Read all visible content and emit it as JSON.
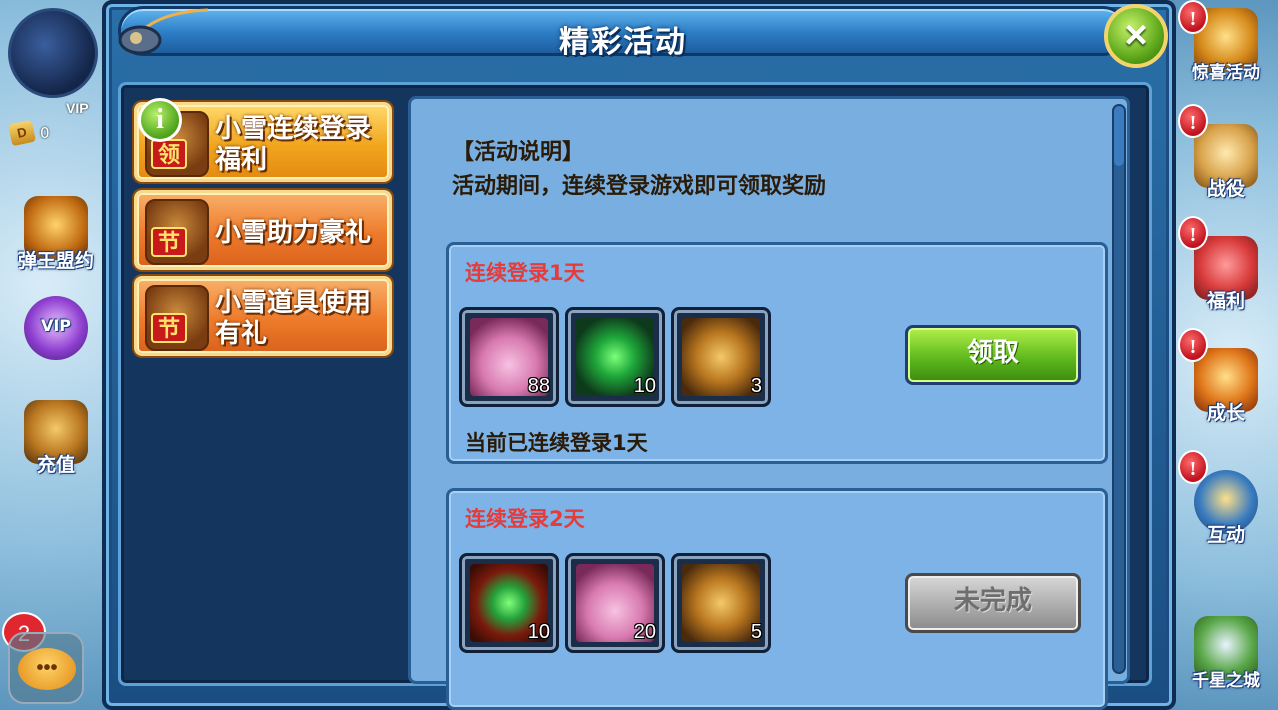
{
  "hud": {
    "vip_label": "VIP",
    "coin_symbol": "D",
    "coin_value": "0",
    "chat_badge": "2",
    "chat_glyph": "•••"
  },
  "left_menu": [
    {
      "label": "弹王盟约",
      "icon": "cannon-icon"
    },
    {
      "label": "VIP",
      "icon": "vip-wings-icon"
    },
    {
      "label": "充值",
      "icon": "treasure-chest-icon"
    }
  ],
  "right_menu": [
    {
      "label": "惊喜活动",
      "icon": "gift-chest-icon",
      "alert": "!"
    },
    {
      "label": "战役",
      "icon": "scroll-map-icon",
      "alert": "!"
    },
    {
      "label": "福利",
      "icon": "gift-bag-icon",
      "alert": "!"
    },
    {
      "label": "成长",
      "icon": "growth-arrow-icon",
      "alert": "!"
    },
    {
      "label": "互动",
      "icon": "crown-badge-icon",
      "alert": "!"
    },
    {
      "label": "千星之城",
      "icon": "castle-icon",
      "alert": ""
    }
  ],
  "dialog": {
    "title": "精彩活动",
    "close_label": "×"
  },
  "tabs": [
    {
      "label": "小雪连续登录福利",
      "tag": "领",
      "badge": "i",
      "state": "active"
    },
    {
      "label": "小雪助力豪礼",
      "tag": "节",
      "state": "inactive"
    },
    {
      "label": "小雪道具使用有礼",
      "tag": "节",
      "state": "inactive"
    }
  ],
  "activity": {
    "desc_title": "【活动说明】",
    "desc_text": "活动期间，连续登录游戏即可领取奖励",
    "rewards": [
      {
        "title": "连续登录1天",
        "status": "当前已连续登录1天",
        "button": "领取",
        "button_state": "claimable",
        "items": [
          {
            "icon": "pink-crystal-icon",
            "count": "88"
          },
          {
            "icon": "green-gem-icon",
            "count": "10"
          },
          {
            "icon": "gold-chest-icon",
            "count": "3"
          }
        ]
      },
      {
        "title": "连续登录2天",
        "status": "",
        "button": "未完成",
        "button_state": "incomplete",
        "items": [
          {
            "icon": "green-orb-icon",
            "count": "10"
          },
          {
            "icon": "pink-crystal-icon",
            "count": "20"
          },
          {
            "icon": "gold-chest-icon",
            "count": "5"
          }
        ]
      }
    ]
  },
  "colors": {
    "accent_green": "#59b51b",
    "title_red": "#e63b3b",
    "panel_blue": "#78aee0"
  }
}
